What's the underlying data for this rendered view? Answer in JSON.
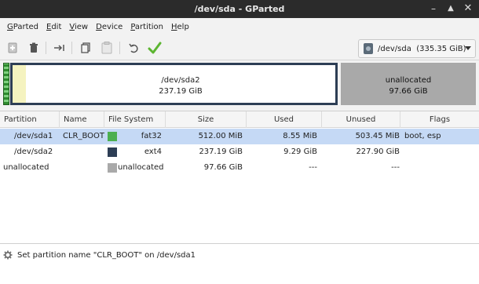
{
  "window": {
    "title": "/dev/sda - GParted"
  },
  "menu": [
    {
      "first": "G",
      "rest": "Parted"
    },
    {
      "first": "E",
      "rest": "dit"
    },
    {
      "first": "V",
      "rest": "iew"
    },
    {
      "first": "D",
      "rest": "evice"
    },
    {
      "first": "P",
      "rest": "artition"
    },
    {
      "first": "H",
      "rest": "elp"
    }
  ],
  "toolbar": {
    "icons": [
      "new-partition-icon",
      "delete-icon",
      "resize-move-icon",
      "copy-icon",
      "paste-icon",
      "undo-icon",
      "apply-icon"
    ],
    "device_selector": "/dev/sda  (335.35 GiB)"
  },
  "diskmap": {
    "sda2": {
      "name": "/dev/sda2",
      "size": "237.19 GiB"
    },
    "unallocated": {
      "name": "unallocated",
      "size": "97.66 GiB"
    }
  },
  "table": {
    "headers": [
      "Partition",
      "Name",
      "File System",
      "Size",
      "Used",
      "Unused",
      "Flags"
    ],
    "rows": [
      {
        "partition": "/dev/sda1",
        "name": "CLR_BOOT",
        "fs": "fat32",
        "fs_color": "#4caf50",
        "size": "512.00 MiB",
        "used": "8.55 MiB",
        "unused": "503.45 MiB",
        "flags": "boot, esp",
        "selected": true
      },
      {
        "partition": "/dev/sda2",
        "name": "",
        "fs": "ext4",
        "fs_color": "#2d3e55",
        "size": "237.19 GiB",
        "used": "9.29 GiB",
        "unused": "227.90 GiB",
        "flags": "",
        "selected": false
      },
      {
        "partition": "unallocated",
        "name": "",
        "fs": "unallocated",
        "fs_color": "#a9a9a9",
        "size": "97.66 GiB",
        "used": "---",
        "unused": "---",
        "flags": "",
        "selected": false
      }
    ]
  },
  "pending": {
    "operation": "Set partition name \"CLR_BOOT\" on /dev/sda1"
  }
}
